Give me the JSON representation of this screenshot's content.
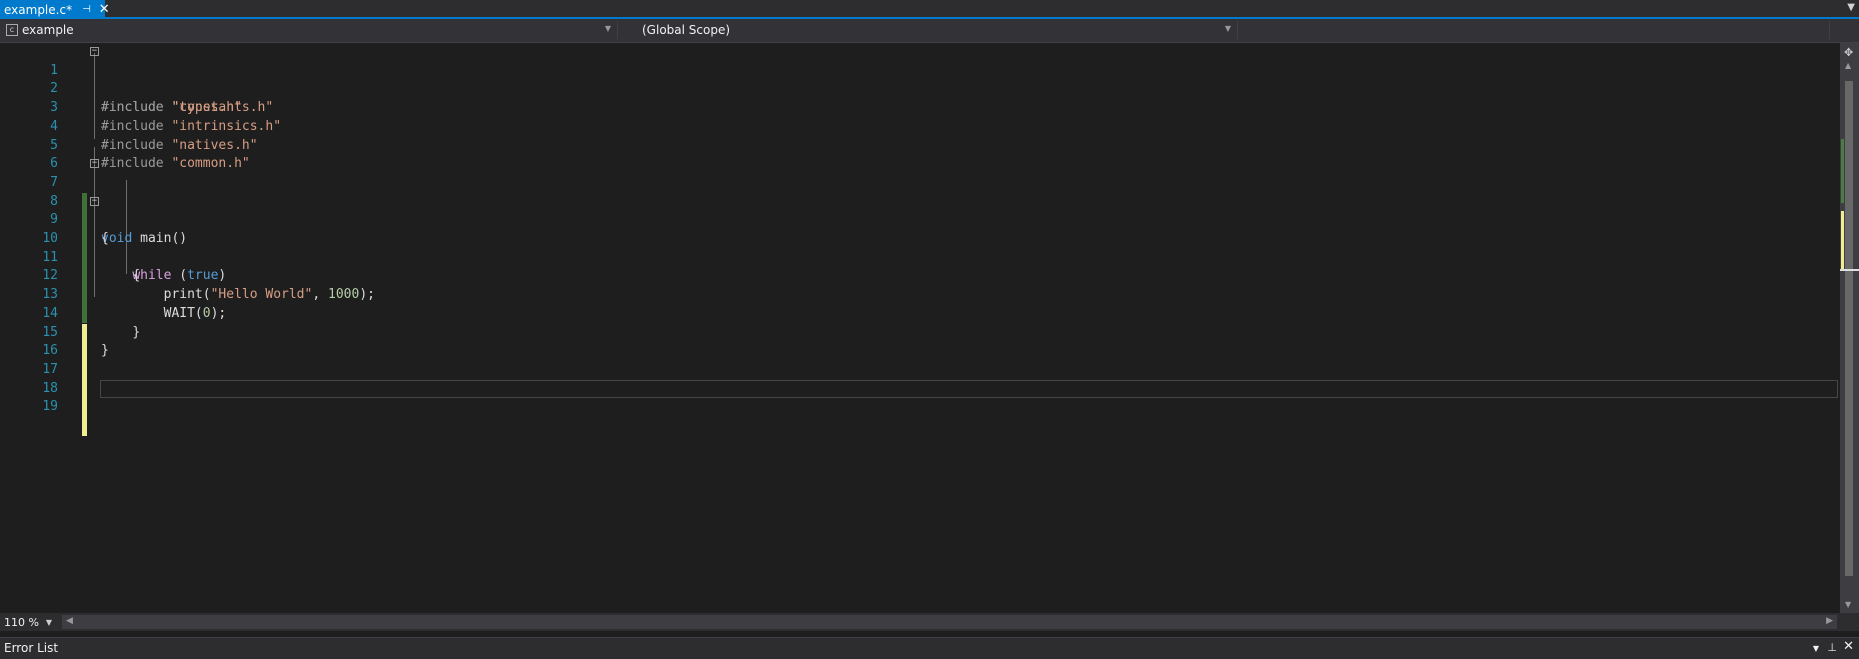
{
  "tabs": [
    {
      "label": "example.c*",
      "pin_icon": "pin-icon",
      "close_icon": "close-icon"
    }
  ],
  "navbar": {
    "project": "example",
    "scope": "(Global Scope)",
    "member": ""
  },
  "editor": {
    "line_numbers": [
      "1",
      "2",
      "3",
      "4",
      "5",
      "6",
      "7",
      "8",
      "9",
      "10",
      "11",
      "12",
      "13",
      "14",
      "15",
      "16",
      "17",
      "18",
      "19"
    ],
    "lines": {
      "l1": {
        "pp": "#include",
        "str": "\"types.h\""
      },
      "l2": {
        "pp": "#include",
        "str": "\"constants.h\""
      },
      "l3": {
        "pp": "#include",
        "str": "\"intrinsics.h\""
      },
      "l4": {
        "pp": "#include",
        "str": "\"natives.h\""
      },
      "l5": {
        "pp": "#include",
        "str": "\"common.h\""
      },
      "l7": {
        "kw": "void",
        "rest": " main()"
      },
      "l8": {
        "text": "{"
      },
      "l9": {
        "ctl": "while",
        "paren_open": " (",
        "kw": "true",
        "paren_close": ")"
      },
      "l10": {
        "text": "{"
      },
      "l11": {
        "fn": "print(",
        "str": "\"Hello World\"",
        "sep": ", ",
        "num": "1000",
        "end": ");"
      },
      "l12": {
        "fn": "WAIT(",
        "num": "0",
        "end": ");"
      },
      "l13": {
        "text": "}"
      },
      "l14": {
        "text": "}"
      }
    }
  },
  "zoom": {
    "value": "110 %"
  },
  "toolwindow": {
    "title": "Error List"
  },
  "colors": {
    "accent": "#007acc",
    "saved_change": "#57a64a",
    "unsaved_change": "#efef91",
    "line_number": "#2b91af",
    "keyword": "#569cd6",
    "control_keyword": "#d8a0df",
    "string": "#d69d85",
    "number": "#b5cea8"
  }
}
